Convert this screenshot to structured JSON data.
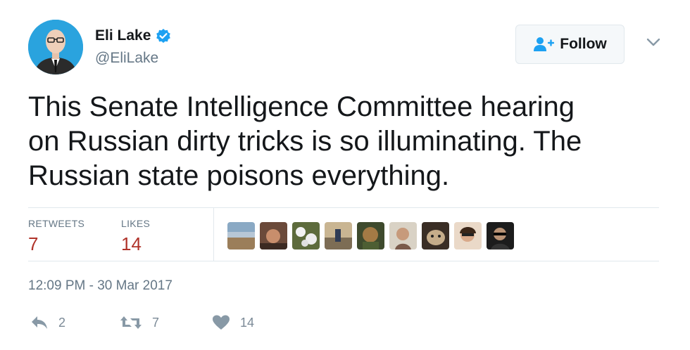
{
  "author": {
    "name": "Eli Lake",
    "handle": "@EliLake",
    "verified": true
  },
  "follow_button": {
    "label": "Follow"
  },
  "tweet": {
    "text": "This Senate Intelligence Committee hearing\non Russian dirty tricks is so illuminating. The\nRussian state poisons everything.",
    "timestamp": "12:09 PM - 30 Mar 2017"
  },
  "stats": {
    "retweets_label": "RETWEETS",
    "retweets_value": "7",
    "likes_label": "LIKES",
    "likes_value": "14"
  },
  "actions": {
    "reply_count": "2",
    "retweet_count": "7",
    "like_count": "14"
  },
  "colors": {
    "accent": "#1da1f2",
    "count_red": "#b0332a",
    "muted": "#657786"
  }
}
